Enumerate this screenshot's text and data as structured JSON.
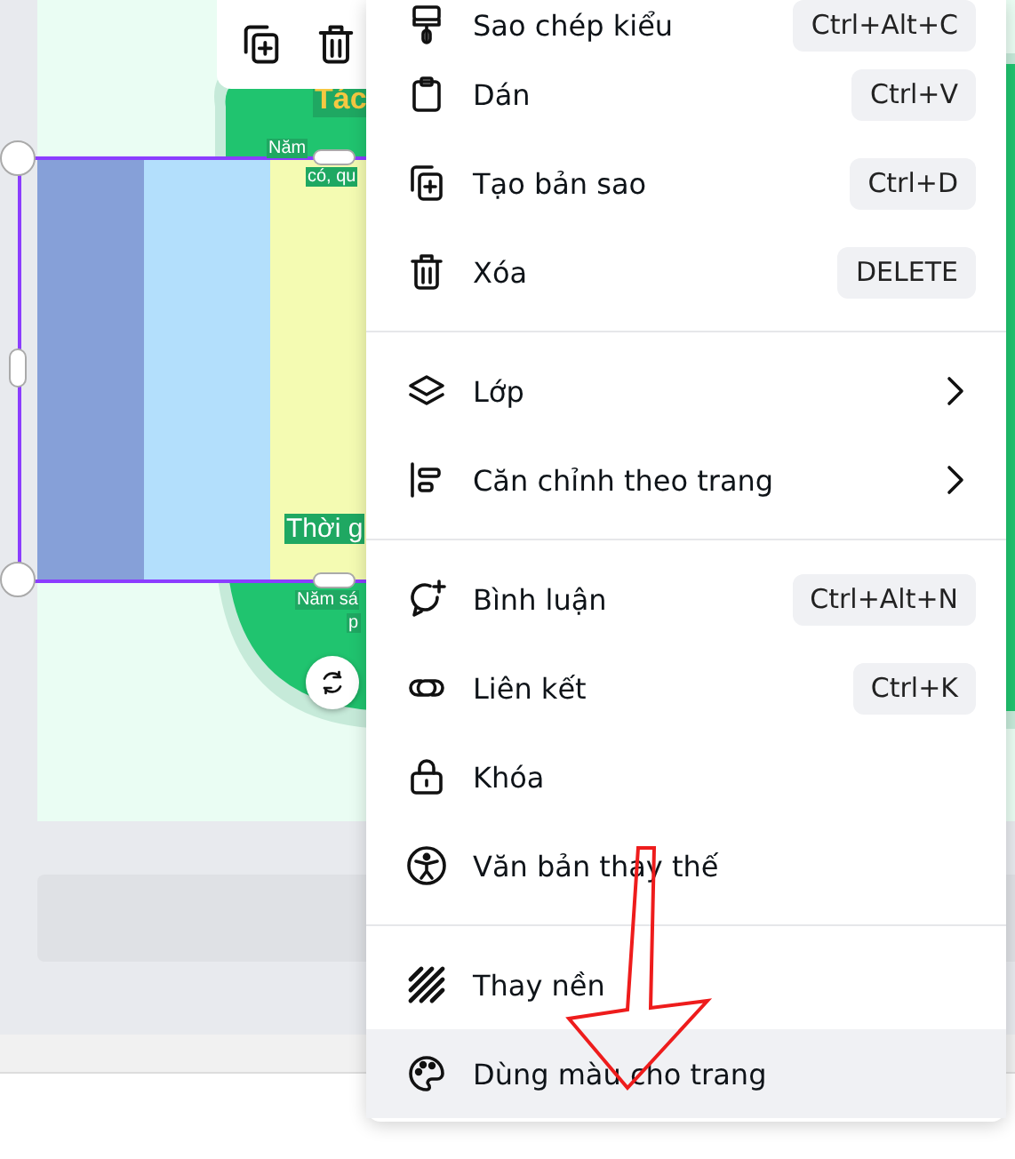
{
  "canvas_texts": [
    {
      "text": "Tác",
      "kind": "heading"
    },
    {
      "text": "Năm",
      "kind": "small"
    },
    {
      "text": "có, qu",
      "kind": "small"
    },
    {
      "text": "Thời g",
      "kind": "subheading"
    },
    {
      "text": "Năm sá",
      "kind": "small"
    },
    {
      "text": "p",
      "kind": "small"
    }
  ],
  "context_menu": {
    "groups": [
      {
        "items": [
          {
            "label": "Sao chép kiểu",
            "shortcut": "Ctrl+Alt+C",
            "submenu": false,
            "selected": false
          },
          {
            "label": "Dán",
            "shortcut": "Ctrl+V",
            "submenu": false,
            "selected": false
          },
          {
            "label": "Tạo bản sao",
            "shortcut": "Ctrl+D",
            "submenu": false,
            "selected": false
          },
          {
            "label": "Xóa",
            "shortcut": "DELETE",
            "submenu": false,
            "selected": false
          }
        ]
      },
      {
        "items": [
          {
            "label": "Lớp",
            "submenu": true,
            "selected": false
          },
          {
            "label": "Căn chỉnh theo trang",
            "submenu": true,
            "selected": false
          }
        ]
      },
      {
        "items": [
          {
            "label": "Bình luận",
            "shortcut": "Ctrl+Alt+N",
            "submenu": false,
            "selected": false
          },
          {
            "label": "Liên kết",
            "shortcut": "Ctrl+K",
            "submenu": false,
            "selected": false
          },
          {
            "label": "Khóa",
            "submenu": false,
            "selected": false
          },
          {
            "label": "Văn bản thay thế",
            "submenu": false,
            "selected": false
          }
        ]
      },
      {
        "items": [
          {
            "label": "Thay nền",
            "submenu": false,
            "selected": false
          },
          {
            "label": "Dùng màu cho trang",
            "submenu": false,
            "selected": true
          }
        ]
      }
    ]
  }
}
